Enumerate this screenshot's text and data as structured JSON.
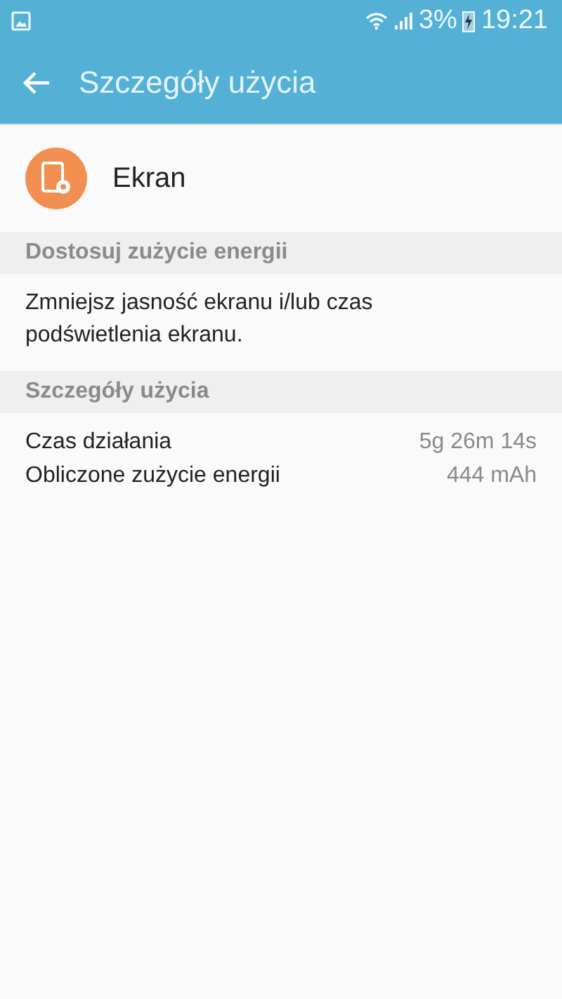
{
  "status_bar": {
    "battery_percent": "3%",
    "time": "19:21"
  },
  "app_bar": {
    "title": "Szczegóły użycia"
  },
  "app": {
    "name": "Ekran"
  },
  "sections": [
    {
      "header": "Dostosuj zużycie energii",
      "kind": "text",
      "text": "Zmniejsz jasność ekranu i/lub czas podświetlenia ekranu."
    },
    {
      "header": "Szczegóły użycia",
      "kind": "details",
      "rows": [
        {
          "label": "Czas działania",
          "value": "5g 26m 14s"
        },
        {
          "label": "Obliczone zużycie energii",
          "value": "444 mAh"
        }
      ]
    }
  ]
}
